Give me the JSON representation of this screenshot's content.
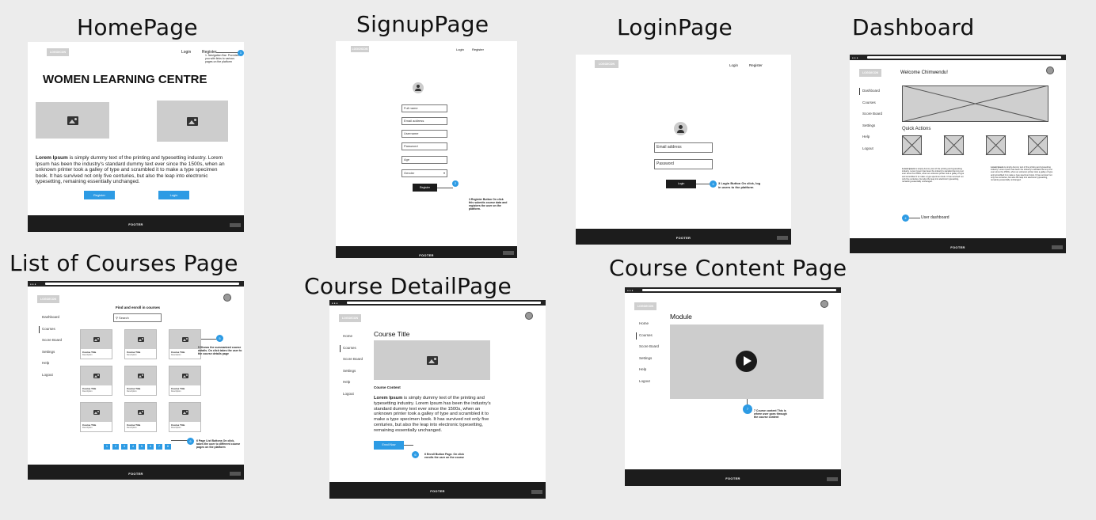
{
  "titles": {
    "home": "HomePage",
    "signup": "SignupPage",
    "login": "LoginPage",
    "dashboard": "Dashboard",
    "courses": "List of Courses Page",
    "detail": "Course DetailPage",
    "content": "Course Content Page"
  },
  "common": {
    "logo": "LOGO/ICON",
    "footer": "FOOTER",
    "nav_login": "Login",
    "nav_register": "Register"
  },
  "home": {
    "headline": "WOMEN LEARNING CENTRE",
    "lorem_bold": "Lorem Ipsum",
    "lorem_text": " is simply dummy text of the printing and typesetting industry. Lorem Ipsum has been the industry's standard dummy text ever since the 1500s, when an unknown printer took a galley of type and scrambled it to make a type specimen book. It has survived not only five centuries, but also the leap into electronic typesetting, remaining essentially unchanged.",
    "register_button": "Register",
    "login_button": "Login",
    "callout_num": "1",
    "callout": "1. Navigation Bar: Provides you with links to various pages on the platform"
  },
  "signup": {
    "fields": [
      "Full name",
      "Email address",
      "Username",
      "Password",
      "Age"
    ],
    "select": "Gender",
    "button": "Register",
    "callout_num": "2",
    "callout": "2.Register Button On click this submits course data and registers the user on the platform."
  },
  "login": {
    "fields": [
      "Email address",
      "Password"
    ],
    "button": "Login",
    "callout_num": "3",
    "callout": "3 Login Button On click, log in users to the platform"
  },
  "dashboard": {
    "welcome": "Welcome Chimwendu!",
    "sidebar": [
      "Dashboard",
      "Courses",
      "Score Board",
      "Settings",
      "Help",
      "Logout"
    ],
    "quick_actions": "Quick Actions",
    "lorem_bold": "Lorem Ipsum",
    "lorem_text": " is simply dummy text of the printing and typesetting industry. Lorem Ipsum has been the industry's standard dummy text ever since the 1500s, when an unknown printer took a galley of type and scrambled it to make a type specimen book. It has survived not only five centuries, but also the leap into electronic typesetting, remaining essentially unchanged.",
    "callout_num": "4",
    "callout": "User dashboard"
  },
  "courses": {
    "heading": "Find and enroll in courses",
    "search_placeholder": "Search",
    "sidebar": [
      "Dashboard",
      "Courses",
      "Score Board",
      "Settings",
      "Help",
      "Logout"
    ],
    "card_title": "Course Title",
    "card_sub": "Description",
    "pages": [
      "1",
      "2",
      "3",
      "4",
      "5",
      "6",
      "7",
      "8"
    ],
    "callout5_num": "5",
    "callout5": "5 Shows the summarized course details. On click takes the user to the course details page",
    "callout6_num": "6",
    "callout6": "6 Page List Buttons On click, takes the user to different course pages on the platform"
  },
  "detail": {
    "sidebar": [
      "Home",
      "Courses",
      "Score Board",
      "Settings",
      "Help",
      "Logout"
    ],
    "course_title": "Course Title",
    "course_content": "Course Content",
    "lorem_bold": "Lorem Ipsum",
    "lorem_text": " is simply dummy text of the printing and typesetting industry. Lorem Ipsum has been the industry's standard dummy text ever since the 1500s, when an unknown printer took a galley of type and scrambled it to make a type specimen book. It has survived not only five centuries, but also the leap into electronic typesetting, remaining essentially unchanged.",
    "enroll_button": "Enroll Now",
    "callout_num": "6",
    "callout": "6 Enroll Button Page. On click enrolls the user on the course"
  },
  "content": {
    "sidebar": [
      "Home",
      "Courses",
      "Score Board",
      "Settings",
      "Help",
      "Logout"
    ],
    "module": "Module",
    "callout_num": "7",
    "callout": "7 Course content This is where user goes through the course content"
  }
}
